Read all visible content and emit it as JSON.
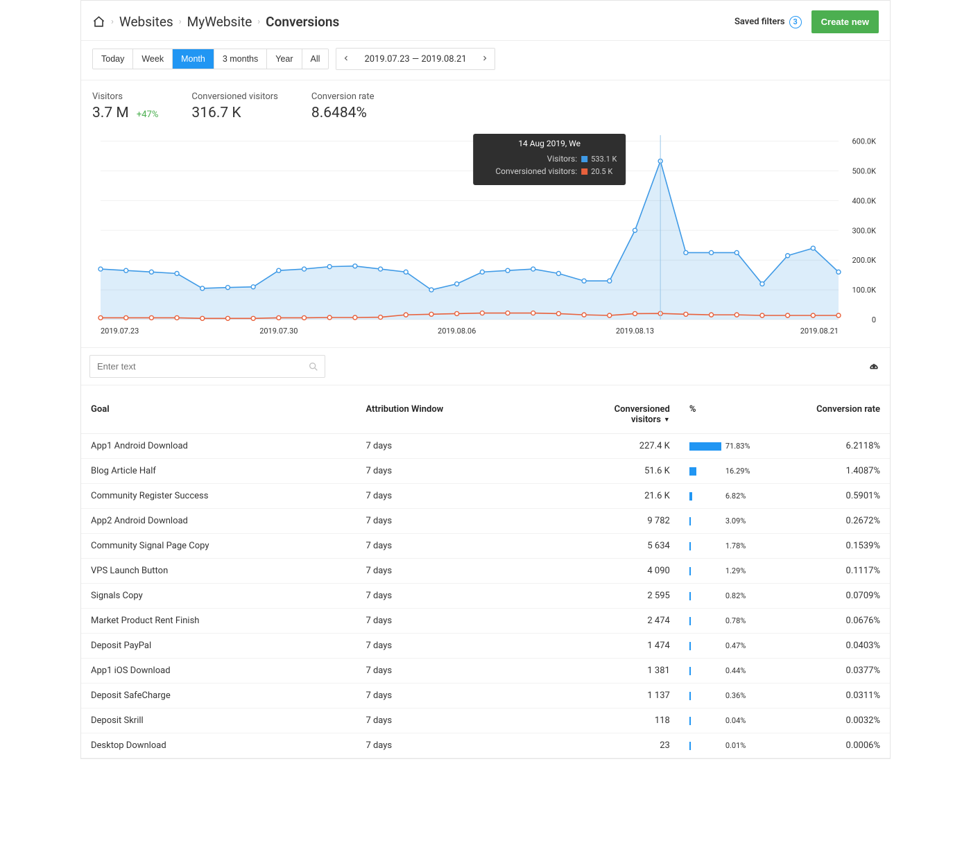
{
  "breadcrumb": {
    "items": [
      "Websites",
      "MyWebsite",
      "Conversions"
    ]
  },
  "header": {
    "saved_filters_label": "Saved filters",
    "saved_filters_count": "3",
    "create_button": "Create new"
  },
  "period_tabs": [
    "Today",
    "Week",
    "Month",
    "3 months",
    "Year",
    "All"
  ],
  "period_active": "Month",
  "date_range": "2019.07.23 — 2019.08.21",
  "metrics": {
    "visitors_label": "Visitors",
    "visitors_value": "3.7 M",
    "visitors_delta": "+47%",
    "conv_vis_label": "Conversioned visitors",
    "conv_vis_value": "316.7 K",
    "conv_rate_label": "Conversion rate",
    "conv_rate_value": "8.6484%"
  },
  "tooltip": {
    "date": "14 Aug 2019, We",
    "row1_label": "Visitors:",
    "row1_value": "533.1 K",
    "row2_label": "Conversioned visitors:",
    "row2_value": "20.5 K"
  },
  "search_placeholder": "Enter text",
  "table": {
    "headers": {
      "goal": "Goal",
      "window": "Attribution Window",
      "cv": "Conversioned\nvisitors",
      "pct": "%",
      "rate": "Conversion rate"
    },
    "rows": [
      {
        "goal": "App1 Android Download",
        "window": "7 days",
        "cv": "227.4 K",
        "pct": 71.83,
        "rate": "6.2118%"
      },
      {
        "goal": "Blog Article Half",
        "window": "7 days",
        "cv": "51.6 K",
        "pct": 16.29,
        "rate": "1.4087%"
      },
      {
        "goal": "Community Register Success",
        "window": "7 days",
        "cv": "21.6 K",
        "pct": 6.82,
        "rate": "0.5901%"
      },
      {
        "goal": "App2 Android Download",
        "window": "7 days",
        "cv": "9 782",
        "pct": 3.09,
        "rate": "0.2672%"
      },
      {
        "goal": "Community Signal Page Copy",
        "window": "7 days",
        "cv": "5 634",
        "pct": 1.78,
        "rate": "0.1539%"
      },
      {
        "goal": "VPS Launch Button",
        "window": "7 days",
        "cv": "4 090",
        "pct": 1.29,
        "rate": "0.1117%"
      },
      {
        "goal": "Signals Copy",
        "window": "7 days",
        "cv": "2 595",
        "pct": 0.82,
        "rate": "0.0709%"
      },
      {
        "goal": "Market Product Rent Finish",
        "window": "7 days",
        "cv": "2 474",
        "pct": 0.78,
        "rate": "0.0676%"
      },
      {
        "goal": "Deposit PayPal",
        "window": "7 days",
        "cv": "1 474",
        "pct": 0.47,
        "rate": "0.0403%"
      },
      {
        "goal": "App1 iOS Download",
        "window": "7 days",
        "cv": "1 381",
        "pct": 0.44,
        "rate": "0.0377%"
      },
      {
        "goal": "Deposit SafeCharge",
        "window": "7 days",
        "cv": "1 137",
        "pct": 0.36,
        "rate": "0.0311%"
      },
      {
        "goal": "Deposit Skrill",
        "window": "7 days",
        "cv": "118",
        "pct": 0.04,
        "rate": "0.0032%"
      },
      {
        "goal": "Desktop Download",
        "window": "7 days",
        "cv": "23",
        "pct": 0.01,
        "rate": "0.0006%"
      }
    ]
  },
  "chart_data": {
    "type": "line",
    "x_tick_labels": [
      "2019.07.23",
      "2019.07.30",
      "2019.08.06",
      "2019.08.13",
      "2019.08.21"
    ],
    "y_ticks": [
      0,
      100,
      200,
      300,
      400,
      500,
      600
    ],
    "y_tick_labels": [
      "0",
      "100.0K",
      "200.0K",
      "300.0K",
      "400.0K",
      "500.0K",
      "600.0K"
    ],
    "ylim": [
      0,
      620
    ],
    "categories": [
      "Jul 23",
      "Jul 24",
      "Jul 25",
      "Jul 26",
      "Jul 27",
      "Jul 28",
      "Jul 29",
      "Jul 30",
      "Jul 31",
      "Aug 01",
      "Aug 02",
      "Aug 03",
      "Aug 04",
      "Aug 05",
      "Aug 06",
      "Aug 07",
      "Aug 08",
      "Aug 09",
      "Aug 10",
      "Aug 11",
      "Aug 12",
      "Aug 13",
      "Aug 14",
      "Aug 15",
      "Aug 16",
      "Aug 17",
      "Aug 18",
      "Aug 19",
      "Aug 20",
      "Aug 21"
    ],
    "series": [
      {
        "name": "Visitors",
        "color": "#3f9ae6",
        "values": [
          170,
          165,
          160,
          155,
          105,
          108,
          110,
          165,
          170,
          178,
          180,
          170,
          160,
          100,
          120,
          160,
          165,
          170,
          155,
          130,
          130,
          300,
          533,
          225,
          225,
          225,
          120,
          215,
          240,
          160
        ]
      },
      {
        "name": "Conversioned visitors",
        "color": "#e8613c",
        "values": [
          6,
          6,
          6,
          6,
          4,
          4,
          4,
          6,
          6,
          7,
          7,
          8,
          16,
          18,
          20,
          22,
          22,
          22,
          20,
          16,
          14,
          20,
          20.5,
          18,
          16,
          16,
          14,
          14,
          14,
          14
        ]
      }
    ],
    "tooltip_index": 22
  }
}
